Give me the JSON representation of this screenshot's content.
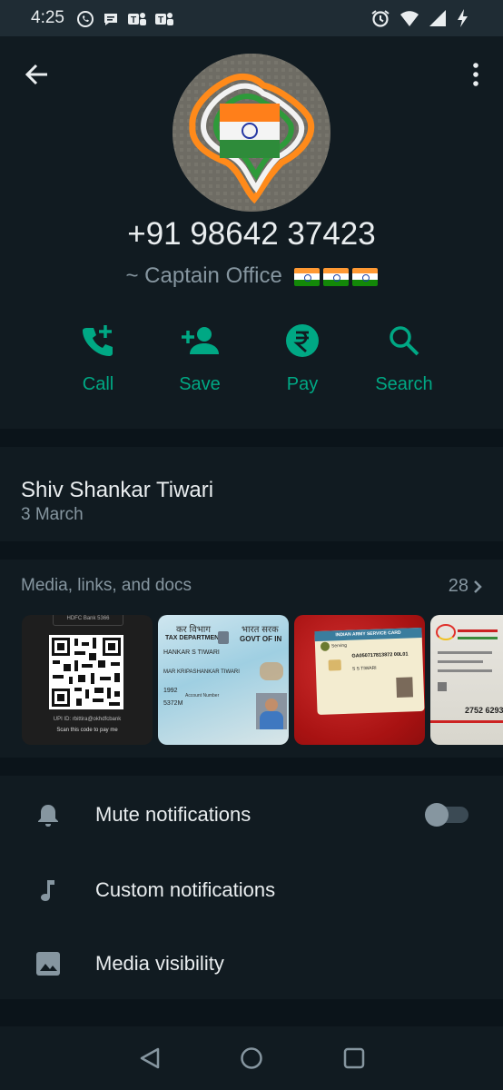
{
  "status_bar": {
    "time": "4:25"
  },
  "contact": {
    "phone": "+91 98642 37423",
    "about_text": "~ Captain Office"
  },
  "actions": [
    {
      "label": "Call",
      "icon": "call-add-icon"
    },
    {
      "label": "Save",
      "icon": "add-person-icon"
    },
    {
      "label": "Pay",
      "icon": "rupee-icon"
    },
    {
      "label": "Search",
      "icon": "search-icon"
    }
  ],
  "info": {
    "name": "Shiv Shankar Tiwari",
    "date": "3 March"
  },
  "media": {
    "title": "Media, links, and docs",
    "count": "28",
    "thumbnails": [
      {
        "top": "HDFC Bank 5366",
        "upi": "UPI ID: rbittira@okhdfcbank",
        "caption": "Scan this code to pay me"
      },
      {
        "dept": "TAX DEPARTMENT",
        "hindi_left": "कर विभाग",
        "hindi_right": "भारत सरक",
        "govt": "GOVT OF IN",
        "name1": "HANKAR S TIWARI",
        "name2": "MAR KRIPASHANKAR TIWARI",
        "dob": "1992",
        "label": "Account Number",
        "code": "5372M"
      },
      {
        "header": "INDIAN ARMY SERVICE CARD",
        "serving": "Serving",
        "serial": "GA050717813872 00L01",
        "role": "S S TIWARI"
      },
      {
        "number": "2752 6293"
      }
    ]
  },
  "settings": [
    {
      "label": "Mute notifications",
      "icon": "bell-icon"
    },
    {
      "label": "Custom notifications",
      "icon": "music-note-icon"
    },
    {
      "label": "Media visibility",
      "icon": "image-icon"
    }
  ],
  "colors": {
    "accent": "#00a884",
    "background": "#0b141a",
    "surface": "#111b21",
    "secondary_text": "#8696a0"
  }
}
